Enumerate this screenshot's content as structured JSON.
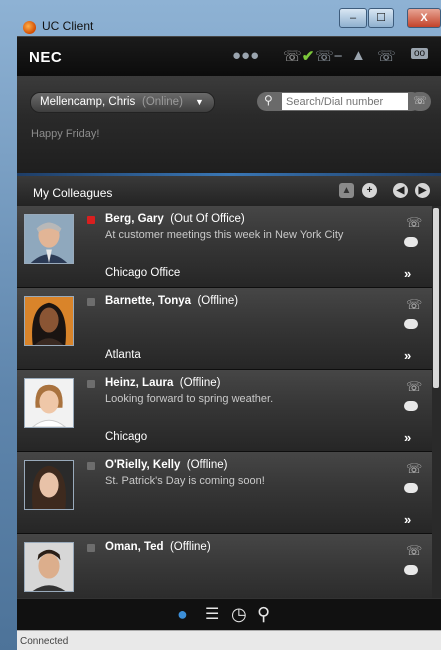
{
  "window": {
    "title": "UC Client",
    "min_label": "–",
    "max_label": "☐",
    "close_label": "X"
  },
  "toolbar": {
    "logo": "NEC"
  },
  "profile": {
    "name": "Mellencamp, Chris",
    "presence": "(Online)",
    "caret": "▼",
    "search_placeholder": "Search/Dial number",
    "note": "Happy Friday!"
  },
  "colleagues": {
    "title": "My Colleagues",
    "items": [
      {
        "name": "Berg, Gary",
        "status": "(Out Of Office)",
        "message": "At customer meetings this week in New York City",
        "location": "Chicago Office",
        "presence": "busy"
      },
      {
        "name": "Barnette, Tonya",
        "status": "(Offline)",
        "message": "",
        "location": "Atlanta",
        "presence": "offline"
      },
      {
        "name": "Heinz, Laura",
        "status": "(Offline)",
        "message": "Looking forward to spring weather.",
        "location": "Chicago",
        "presence": "offline"
      },
      {
        "name": "O'Rielly, Kelly",
        "status": "(Offline)",
        "message": "St. Patrick's Day is coming soon!",
        "location": "",
        "presence": "offline"
      },
      {
        "name": "Oman, Ted",
        "status": "(Offline)",
        "message": "",
        "location": "",
        "presence": "offline"
      }
    ]
  },
  "statusbar": {
    "text": "Connected"
  },
  "icons": {
    "toolbar": [
      "group-icon",
      "call-status-icon",
      "call-forward-icon",
      "user-menu-icon",
      "phone-menu-icon",
      "voicemail-icon"
    ],
    "footer": [
      "contacts-icon",
      "directory-icon",
      "history-icon",
      "search-icon"
    ]
  },
  "colors": {
    "accent": "#3a77b5",
    "busy": "#d91f1f",
    "offline": "#6d6d6d",
    "footer_active": "#3c8fd8"
  }
}
